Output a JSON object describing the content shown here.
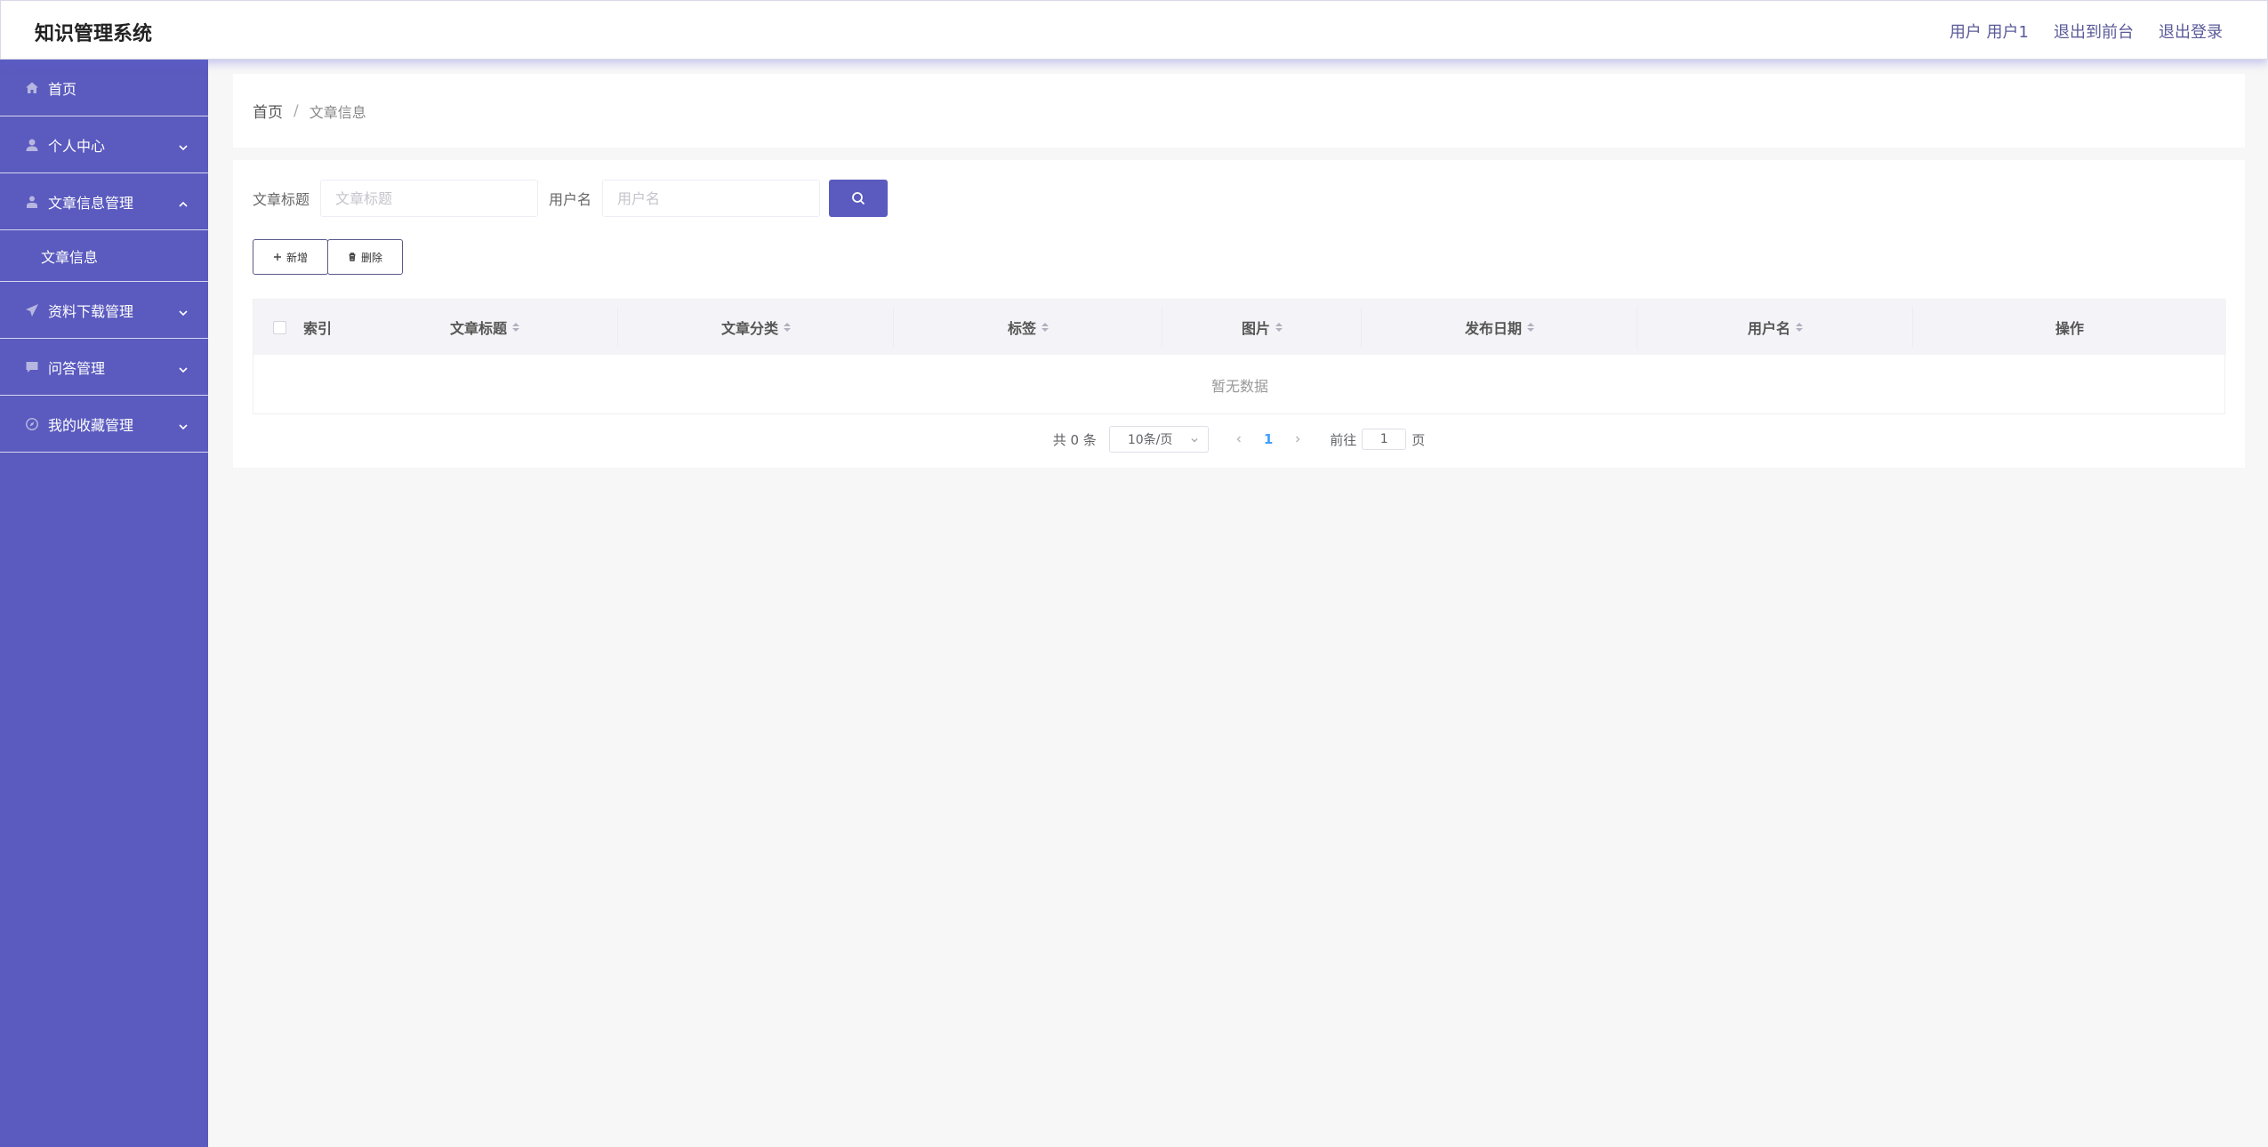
{
  "header": {
    "brand": "知识管理系统",
    "user_label": "用户 用户1",
    "back_front": "退出到前台",
    "logout": "退出登录"
  },
  "sidebar": {
    "items": [
      {
        "label": "首页",
        "icon": "home-icon"
      },
      {
        "label": "个人中心",
        "icon": "user-icon",
        "arrow": "down"
      },
      {
        "label": "文章信息管理",
        "icon": "user-icon",
        "arrow": "up"
      },
      {
        "label": "文章信息",
        "submenu": true
      },
      {
        "label": "资料下载管理",
        "icon": "send-icon",
        "arrow": "down"
      },
      {
        "label": "问答管理",
        "icon": "chat-icon",
        "arrow": "down"
      },
      {
        "label": "我的收藏管理",
        "icon": "compass-icon",
        "arrow": "down"
      }
    ]
  },
  "breadcrumb": {
    "home": "首页",
    "separator": "/",
    "current": "文章信息"
  },
  "search": {
    "title_label": "文章标题",
    "title_placeholder": "文章标题",
    "user_label": "用户名",
    "user_placeholder": "用户名"
  },
  "actions": {
    "add": "新增",
    "delete": "删除"
  },
  "table": {
    "columns": [
      "索引",
      "文章标题",
      "文章分类",
      "标签",
      "图片",
      "发布日期",
      "用户名",
      "操作"
    ],
    "empty_text": "暂无数据"
  },
  "pagination": {
    "total": "共 0 条",
    "page_size": "10条/页",
    "current_page": "1",
    "goto_prefix": "前往",
    "goto_value": "1",
    "goto_suffix": "页"
  },
  "colors": {
    "sidebar": "#5a5abf",
    "accent": "#5a5abf",
    "page_active": "#409eff"
  }
}
